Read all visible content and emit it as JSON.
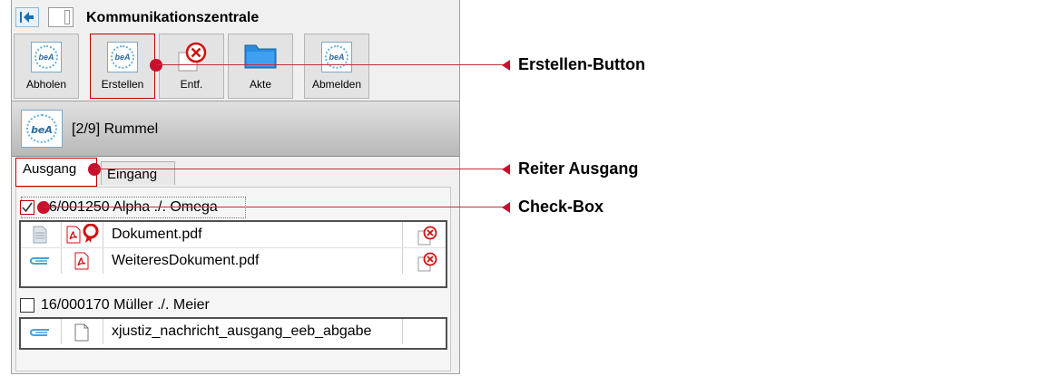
{
  "window": {
    "title": "Kommunikationszentrale"
  },
  "toolbar": {
    "buttons": [
      {
        "label": "Abholen",
        "icon": "bea-icon"
      },
      {
        "label": "Erstellen",
        "icon": "bea-icon"
      },
      {
        "label": "Entf.",
        "icon": "delete-icon"
      },
      {
        "label": "Akte",
        "icon": "folder-icon"
      },
      {
        "label": "Abmelden",
        "icon": "bea-icon"
      }
    ]
  },
  "account": {
    "name": "[2/9] Rummel",
    "logo_text": "beA"
  },
  "tabs": [
    {
      "label": "Ausgang",
      "active": true
    },
    {
      "label": "Eingang",
      "active": false
    }
  ],
  "cases": [
    {
      "label": "16/001250  Alpha ./. Omega",
      "checked": true,
      "documents": [
        {
          "name": "Dokument.pdf",
          "icons": [
            "document-icon",
            "pdf-icon",
            "signature-seal-icon"
          ],
          "delete_icon": "delete-icon"
        },
        {
          "name": "WeiteresDokument.pdf",
          "icons": [
            "attachment-icon",
            "pdf-icon"
          ],
          "delete_icon": "delete-icon"
        }
      ]
    },
    {
      "label": "16/000170  Müller ./. Meier",
      "checked": false,
      "documents": [
        {
          "name": "xjustiz_nachricht_ausgang_eeb_abgabe",
          "icons": [
            "attachment-icon",
            "blank-file-icon"
          ]
        }
      ]
    }
  ],
  "callouts": [
    {
      "label": "Erstellen-Button"
    },
    {
      "label": "Reiter Ausgang"
    },
    {
      "label": "Check-Box"
    }
  ],
  "colors": {
    "callout": "#c8102e",
    "accent": "#1a6fb3"
  }
}
